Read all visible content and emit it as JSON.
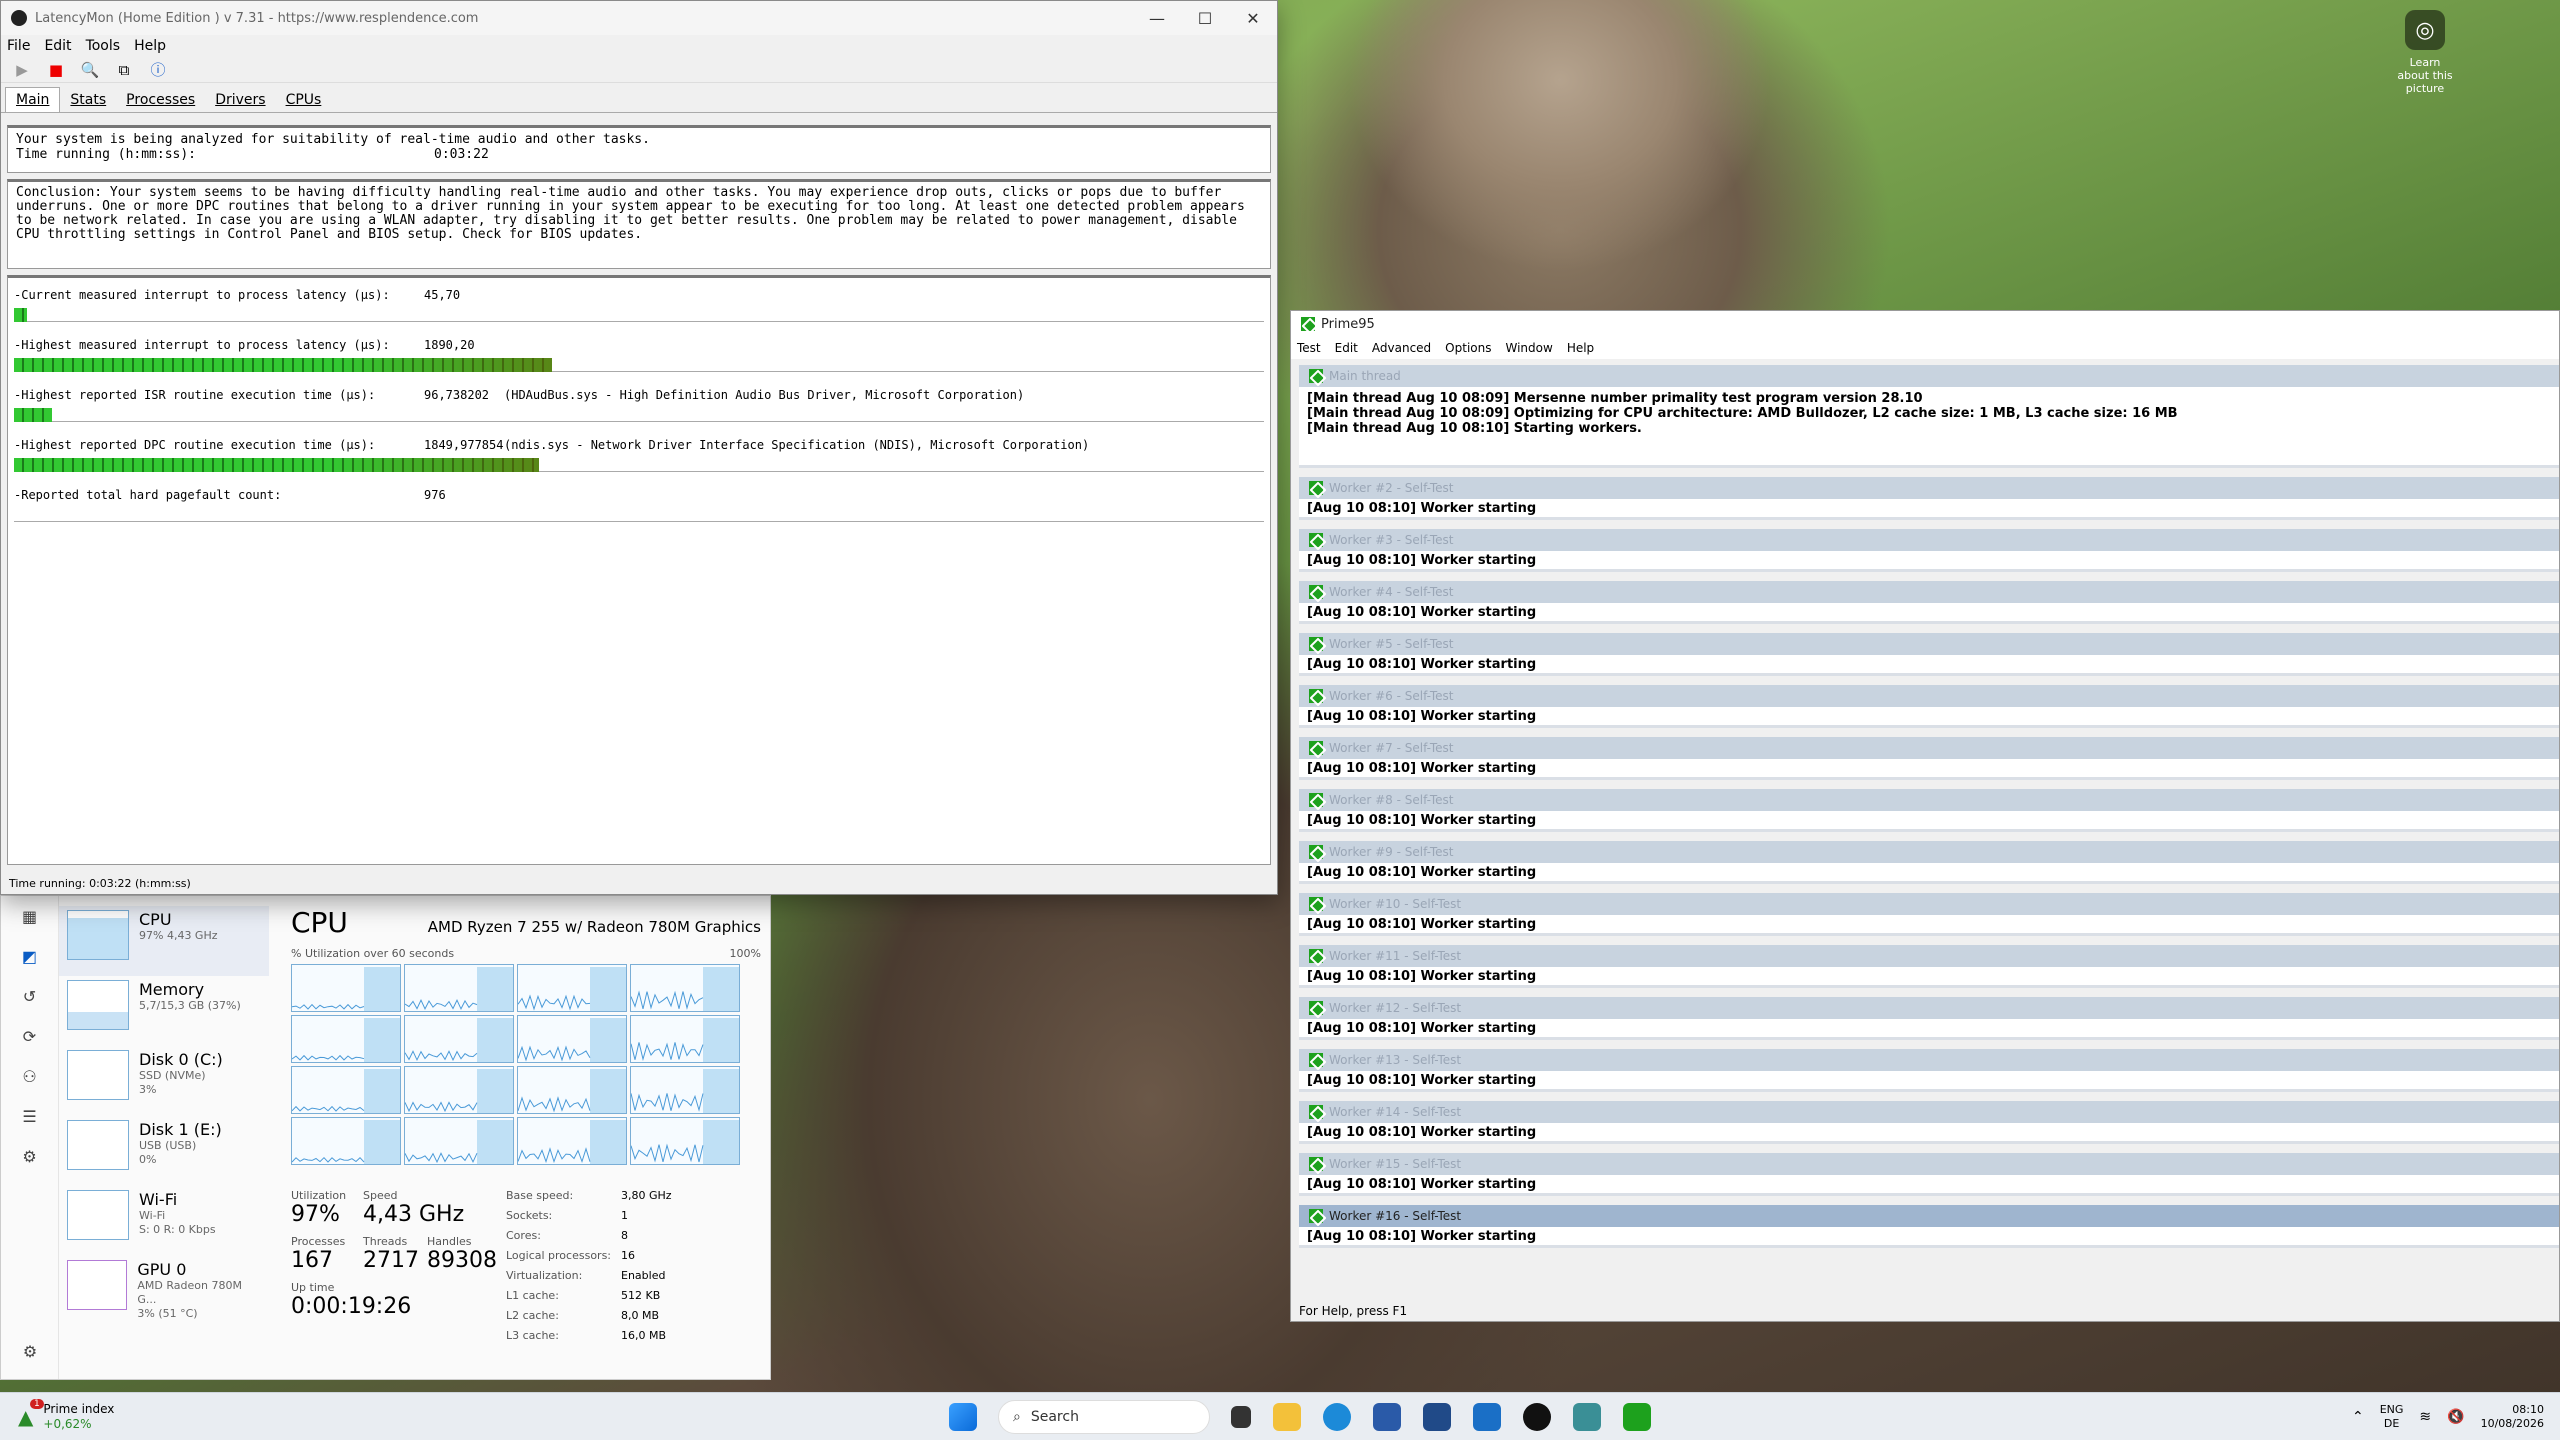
{
  "desktop": {
    "learn_label": "Learn about this picture"
  },
  "latencymon": {
    "title": "LatencyMon  (Home Edition )  v 7.31 - https://www.resplendence.com",
    "menu": [
      "File",
      "Edit",
      "Tools",
      "Help"
    ],
    "tabs": [
      "Main",
      "Stats",
      "Processes",
      "Drivers",
      "CPUs"
    ],
    "status1": "Your system is being analyzed for suitability of real-time audio and other tasks.",
    "time_label": "Time running (h:mm:ss):",
    "time_value": "0:03:22",
    "conclusion": "Conclusion: Your system seems to be having difficulty handling real-time audio and other tasks. You may experience drop outs, clicks or pops due to buffer underruns. One or more DPC routines that belong to a driver running in your system appear to be executing for too long. At least one detected problem appears to be network related. In case you are using a WLAN adapter, try disabling it to get better results. One problem may be related to power management, disable CPU throttling settings in Control Panel and BIOS setup. Check for BIOS updates.",
    "rows": [
      {
        "label": "-Current measured interrupt to process latency (µs):",
        "value": "45,70",
        "extra": "",
        "fill": 0.01
      },
      {
        "label": "-Highest measured interrupt to process latency (µs):",
        "value": "1890,20",
        "extra": "",
        "fill": 0.43
      },
      {
        "label": "-Highest reported ISR routine execution time (µs):",
        "value": "96,738202",
        "extra": "(HDAudBus.sys - High Definition Audio Bus Driver, Microsoft Corporation)",
        "fill": 0.03
      },
      {
        "label": "-Highest reported DPC routine execution time (µs):",
        "value": "1849,977854",
        "extra": "(ndis.sys - Network Driver Interface Specification (NDIS), Microsoft Corporation)",
        "fill": 0.42
      },
      {
        "label": "-Reported total hard pagefault count:",
        "value": "976",
        "extra": "",
        "fill": 0
      }
    ],
    "statusbar": "Time running: 0:03:22  (h:mm:ss)"
  },
  "taskmgr": {
    "items": [
      {
        "name": "CPU",
        "sub": "97%  4,43 GHz",
        "sub2": ""
      },
      {
        "name": "Memory",
        "sub": "5,7/15,3 GB (37%)",
        "sub2": ""
      },
      {
        "name": "Disk 0 (C:)",
        "sub": "SSD (NVMe)",
        "sub2": "3%"
      },
      {
        "name": "Disk 1 (E:)",
        "sub": "USB (USB)",
        "sub2": "0%"
      },
      {
        "name": "Wi-Fi",
        "sub": "Wi-Fi",
        "sub2": "S: 0 R: 0 Kbps"
      },
      {
        "name": "GPU 0",
        "sub": "AMD Radeon 780M G...",
        "sub2": "3% (51 °C)"
      }
    ],
    "title": "CPU",
    "cpu_name": "AMD Ryzen 7 255 w/ Radeon 780M Graphics",
    "graph_label": "% Utilization over 60 seconds",
    "graph_max": "100%",
    "utilization_label": "Utilization",
    "utilization": "97%",
    "speed_label": "Speed",
    "speed": "4,43 GHz",
    "processes_label": "Processes",
    "processes": "167",
    "threads_label": "Threads",
    "threads": "2717",
    "handles_label": "Handles",
    "handles": "89308",
    "uptime_label": "Up time",
    "uptime": "0:00:19:26",
    "specs": [
      {
        "k": "Base speed:",
        "v": "3,80 GHz"
      },
      {
        "k": "Sockets:",
        "v": "1"
      },
      {
        "k": "Cores:",
        "v": "8"
      },
      {
        "k": "Logical processors:",
        "v": "16"
      },
      {
        "k": "Virtualization:",
        "v": "Enabled"
      },
      {
        "k": "L1 cache:",
        "v": "512 KB"
      },
      {
        "k": "L2 cache:",
        "v": "8,0 MB"
      },
      {
        "k": "L3 cache:",
        "v": "16,0 MB"
      }
    ]
  },
  "prime95": {
    "title": "Prime95",
    "menu": [
      "Test",
      "Edit",
      "Advanced",
      "Options",
      "Window",
      "Help"
    ],
    "main_title": "Main thread",
    "main_lines": [
      "[Main thread Aug 10 08:09] Mersenne number primality test program version 28.10",
      "[Main thread Aug 10 08:09] Optimizing for CPU architecture: AMD Bulldozer, L2 cache size: 1 MB, L3 cache size: 16 MB",
      "[Main thread Aug 10 08:10] Starting workers."
    ],
    "workers": [
      {
        "title": "Worker #2 - Self-Test",
        "line": "[Aug 10 08:10] Worker starting"
      },
      {
        "title": "Worker #3 - Self-Test",
        "line": "[Aug 10 08:10] Worker starting"
      },
      {
        "title": "Worker #4 - Self-Test",
        "line": "[Aug 10 08:10] Worker starting"
      },
      {
        "title": "Worker #5 - Self-Test",
        "line": "[Aug 10 08:10] Worker starting"
      },
      {
        "title": "Worker #6 - Self-Test",
        "line": "[Aug 10 08:10] Worker starting"
      },
      {
        "title": "Worker #7 - Self-Test",
        "line": "[Aug 10 08:10] Worker starting"
      },
      {
        "title": "Worker #8 - Self-Test",
        "line": "[Aug 10 08:10] Worker starting"
      },
      {
        "title": "Worker #9 - Self-Test",
        "line": "[Aug 10 08:10] Worker starting"
      },
      {
        "title": "Worker #10 - Self-Test",
        "line": "[Aug 10 08:10] Worker starting"
      },
      {
        "title": "Worker #11 - Self-Test",
        "line": "[Aug 10 08:10] Worker starting"
      },
      {
        "title": "Worker #12 - Self-Test",
        "line": "[Aug 10 08:10] Worker starting"
      },
      {
        "title": "Worker #13 - Self-Test",
        "line": "[Aug 10 08:10] Worker starting"
      },
      {
        "title": "Worker #14 - Self-Test",
        "line": "[Aug 10 08:10] Worker starting"
      },
      {
        "title": "Worker #15 - Self-Test",
        "line": "[Aug 10 08:10] Worker starting"
      },
      {
        "title": "Worker #16 - Self-Test",
        "line": "[Aug 10 08:10] Worker starting"
      }
    ],
    "statusbar": "For Help, press F1"
  },
  "taskbar": {
    "widget_name": "Prime index",
    "widget_value": "+0,62%",
    "widget_badge": "1",
    "search": "Search",
    "lang1": "ENG",
    "lang2": "DE",
    "time": "08:10",
    "date": "10/08/2026"
  }
}
